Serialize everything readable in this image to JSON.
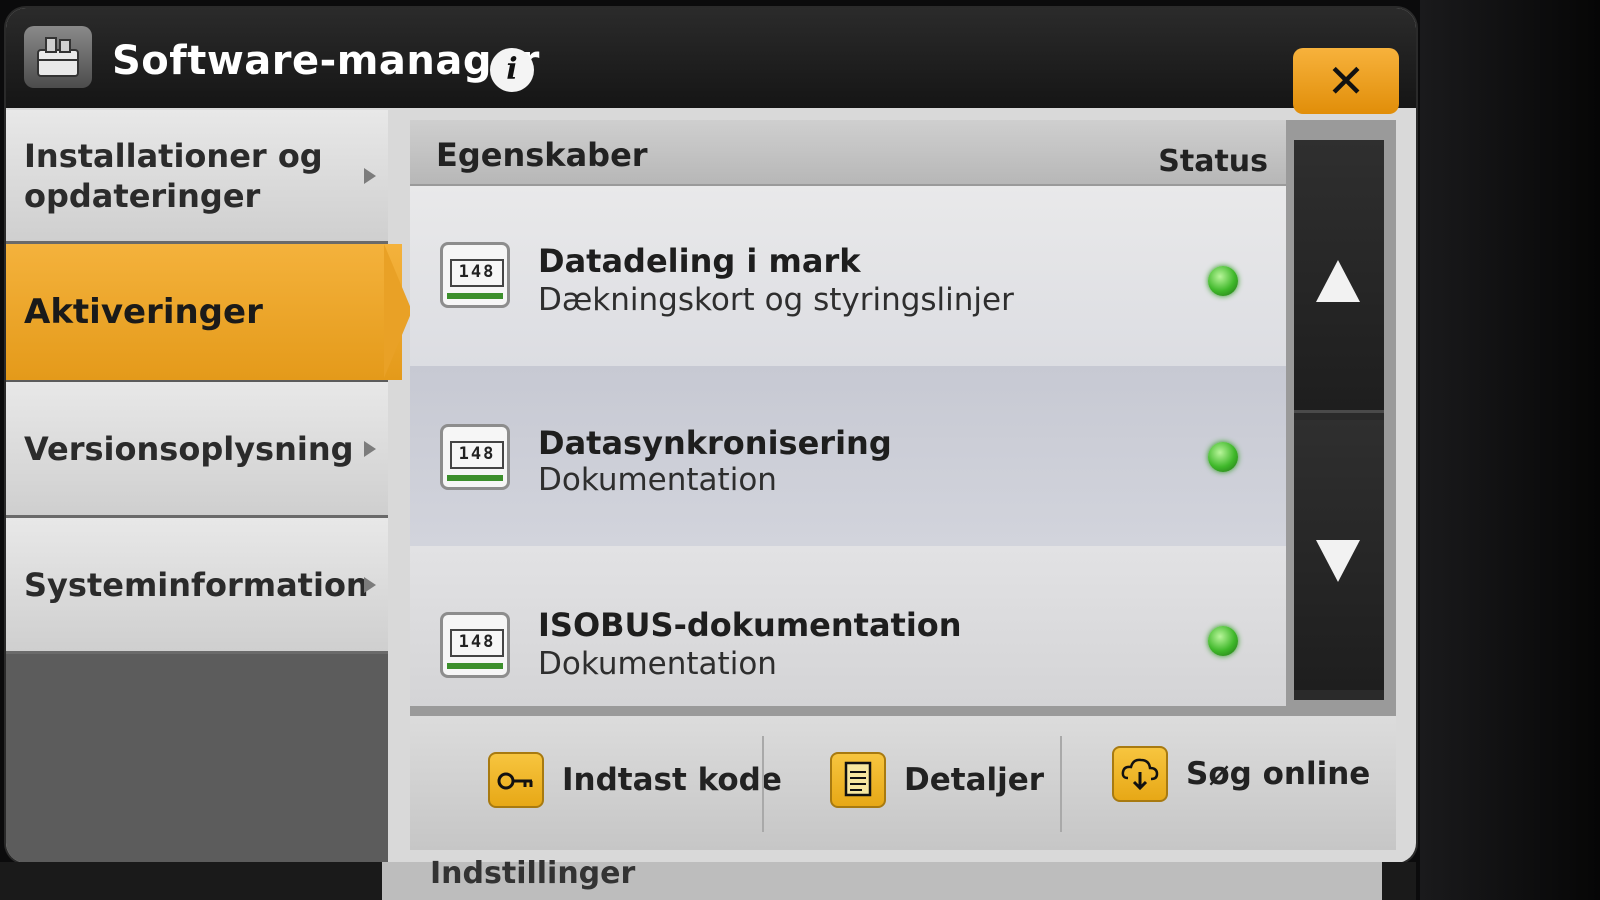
{
  "header": {
    "title": "Software-manager",
    "info_icon": "info-icon",
    "close_label": "✕"
  },
  "sidebar": {
    "items": [
      {
        "label": "Installationer og opdateringer",
        "active": false
      },
      {
        "label": "Aktiveringer",
        "active": true
      },
      {
        "label": "Versionsoplysninger",
        "active": false
      },
      {
        "label": "Systeminformation",
        "active": false
      }
    ]
  },
  "table": {
    "col_properties": "Egenskaber",
    "col_status": "Status",
    "rows": [
      {
        "icon_text": "1|4|8",
        "title": "Datadeling i mark",
        "subtitle": "Dækningskort og styringslinjer",
        "status_color": "#3fb82a"
      },
      {
        "icon_text": "1|4|8",
        "title": "Datasynkronisering",
        "subtitle": "Dokumentation",
        "status_color": "#3fb82a"
      },
      {
        "icon_text": "1|4|8",
        "title": "ISOBUS-dokumentation",
        "subtitle": "Dokumentation",
        "status_color": "#3fb82a"
      }
    ]
  },
  "actions": {
    "enter_code": "Indtast kode",
    "details": "Detaljer",
    "search_online": "Søg online"
  },
  "below": {
    "label": "Indstillinger"
  },
  "colors": {
    "accent": "#e9a126",
    "status_ok": "#3fb82a"
  }
}
